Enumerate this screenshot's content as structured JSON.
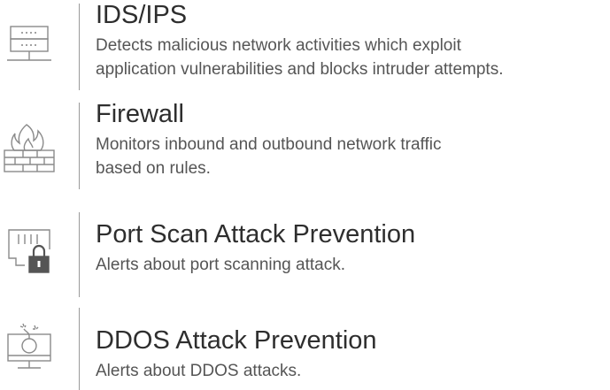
{
  "features": [
    {
      "icon": "server-rack-icon",
      "title": "IDS/IPS",
      "description_line1": "Detects malicious network activities which exploit",
      "description_line2": "application vulnerabilities and blocks intruder attempts."
    },
    {
      "icon": "firewall-icon",
      "title": "Firewall",
      "description_line1": "Monitors inbound and outbound network traffic",
      "description_line2": "based on rules."
    },
    {
      "icon": "port-lock-icon",
      "title": "Port Scan Attack Prevention",
      "description_line1": "Alerts about port scanning attack."
    },
    {
      "icon": "monitor-bomb-icon",
      "title": "DDOS Attack Prevention",
      "description_line1": "Alerts about DDOS attacks."
    }
  ]
}
